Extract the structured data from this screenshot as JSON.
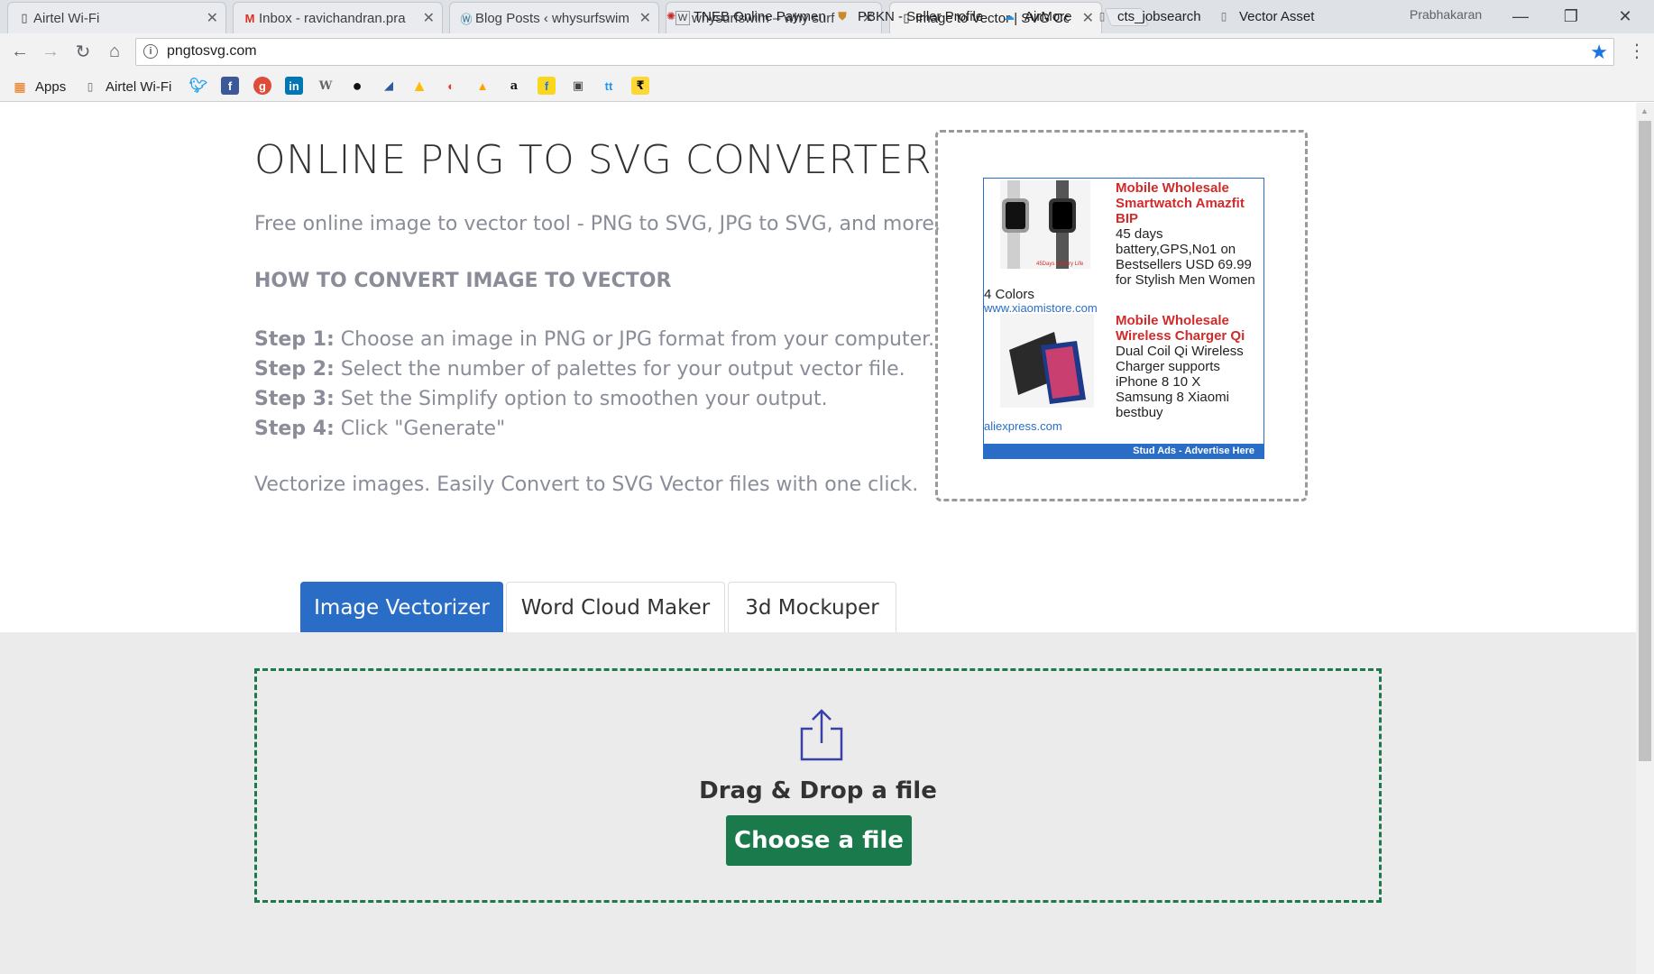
{
  "browser": {
    "tabs": [
      {
        "label": "Airtel Wi-Fi"
      },
      {
        "label": "Inbox - ravichandran.pra"
      },
      {
        "label": "Blog Posts ‹ whysurfswim"
      },
      {
        "label": "whysurfswim – why surf"
      },
      {
        "label": "Image to Vector | SVG Co"
      }
    ],
    "profile_name": "Prabhakaran",
    "url": "pngtosvg.com",
    "bookmarks": {
      "apps": "Apps",
      "airtel": "Airtel Wi-Fi",
      "tneb": "TNEB Online Paymen",
      "pbkn": "PBKN - Seller Profile",
      "airmore": "AirMore",
      "cts": "cts_jobsearch",
      "vector": "Vector Asset"
    }
  },
  "page": {
    "title": "ONLINE PNG TO SVG CONVERTER",
    "subtitle": "Free online image to vector tool - PNG to SVG, JPG to SVG, and more.",
    "howto_heading": "HOW TO CONVERT IMAGE TO VECTOR",
    "steps": [
      {
        "label": "Step 1:",
        "text": "Choose an image in PNG or JPG format from your computer."
      },
      {
        "label": "Step 2:",
        "text": "Select the number of palettes for your output vector file."
      },
      {
        "label": "Step 3:",
        "text": "Set the Simplify option to smoothen your output."
      },
      {
        "label": "Step 4:",
        "text": "Click \"Generate\""
      }
    ],
    "tagline": "Vectorize images. Easily Convert to SVG Vector files with one click.",
    "tool_tabs": [
      "Image Vectorizer",
      "Word Cloud Maker",
      "3d Mockuper"
    ],
    "dropzone_text": "Drag & Drop a file",
    "choose_button": "Choose a file"
  },
  "ad": {
    "items": [
      {
        "title": "Mobile Wholesale Smartwatch Amazfit BIP",
        "desc": "45 days battery,GPS,No1 on Bestsellers USD 69.99 for Stylish Men Women",
        "extra": "4 Colors",
        "link": "www.xiaomistore.com"
      },
      {
        "title": "Mobile Wholesale Wireless Charger Qi",
        "desc": "Dual Coil Qi Wireless Charger supports iPhone 8 10 X Samsung 8 Xiaomi bestbuy",
        "link": "aliexpress.com"
      }
    ],
    "footer": "Stud Ads - Advertise Here"
  }
}
